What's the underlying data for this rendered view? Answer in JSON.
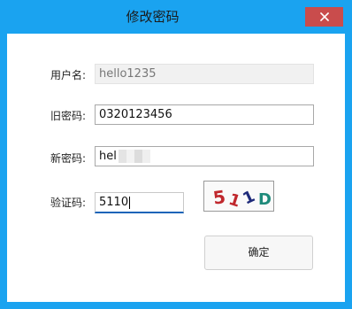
{
  "window": {
    "title": "修改密码",
    "accent_color": "#1aa3f0",
    "close_icon": "close-icon"
  },
  "form": {
    "username": {
      "label": "用户名:",
      "value": "hello1235",
      "disabled": true
    },
    "old_password": {
      "label": "旧密码:",
      "value": "0320123456"
    },
    "new_password": {
      "label": "新密码:",
      "value_visible": "hel"
    },
    "captcha_input": {
      "label": "验证码:",
      "value": "5110"
    },
    "captcha_image": {
      "characters": [
        "5",
        "1",
        "1",
        "D"
      ]
    }
  },
  "buttons": {
    "confirm": "确定"
  }
}
